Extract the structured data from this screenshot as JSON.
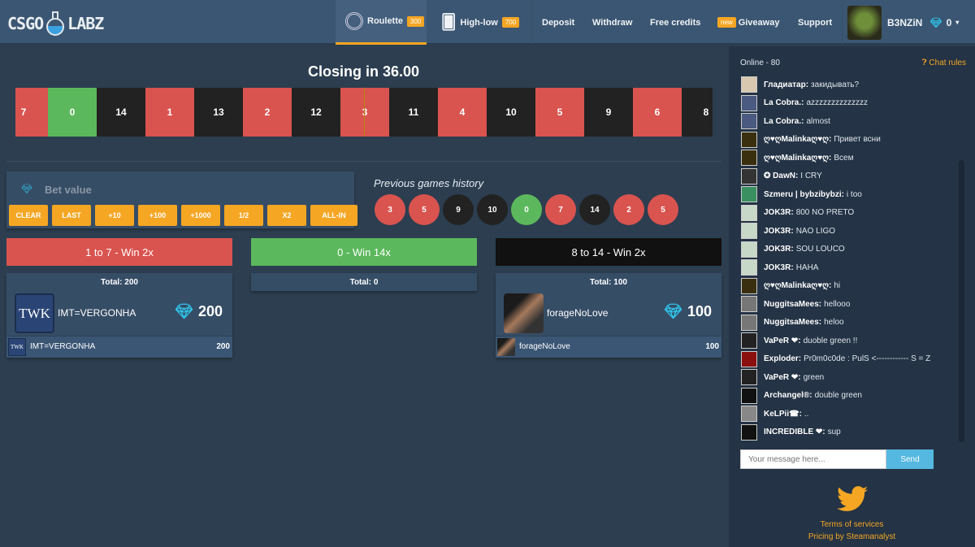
{
  "header": {
    "logo_left": "CSGO",
    "logo_right": "LABZ",
    "nav": [
      {
        "label": "Roulette",
        "badge": "300"
      },
      {
        "label": "High-low",
        "badge": "700"
      },
      {
        "label": "Deposit"
      },
      {
        "label": "Withdraw"
      },
      {
        "label": "Free credits"
      },
      {
        "label": "Giveaway",
        "badge": "new"
      },
      {
        "label": "Support"
      }
    ],
    "user": {
      "name": "B3NZiN",
      "balance": "0"
    }
  },
  "roulette": {
    "title": "Closing in 36.00",
    "tiles": [
      {
        "n": "7",
        "c": "red"
      },
      {
        "n": "0",
        "c": "green"
      },
      {
        "n": "14",
        "c": "black"
      },
      {
        "n": "1",
        "c": "red"
      },
      {
        "n": "13",
        "c": "black"
      },
      {
        "n": "2",
        "c": "red"
      },
      {
        "n": "12",
        "c": "black"
      },
      {
        "n": "3",
        "c": "red"
      },
      {
        "n": "11",
        "c": "black"
      },
      {
        "n": "4",
        "c": "red"
      },
      {
        "n": "10",
        "c": "black"
      },
      {
        "n": "5",
        "c": "red"
      },
      {
        "n": "9",
        "c": "black"
      },
      {
        "n": "6",
        "c": "red"
      },
      {
        "n": "8",
        "c": "black"
      }
    ]
  },
  "colors": {
    "red": "#d9534f",
    "green": "#5cb85c",
    "black": "#222222",
    "accent": "#f5a623",
    "gem": "#2fc4ea"
  },
  "bet": {
    "label": "Bet value",
    "buttons": [
      "CLEAR",
      "LAST",
      "+10",
      "+100",
      "+1000",
      "1/2",
      "X2",
      "ALL-IN"
    ]
  },
  "history": {
    "label": "Previous games history",
    "balls": [
      {
        "n": "3",
        "c": "red"
      },
      {
        "n": "5",
        "c": "red"
      },
      {
        "n": "9",
        "c": "black"
      },
      {
        "n": "10",
        "c": "black"
      },
      {
        "n": "0",
        "c": "green"
      },
      {
        "n": "7",
        "c": "red"
      },
      {
        "n": "14",
        "c": "black"
      },
      {
        "n": "2",
        "c": "red"
      },
      {
        "n": "5",
        "c": "red"
      }
    ]
  },
  "columns": [
    {
      "label": "1 to 7 - Win 2x",
      "color": "red",
      "total": "Total: 200",
      "top": {
        "name": "IMT=VERGONHA",
        "amount": "200",
        "avatar_text": "TWK"
      },
      "bets": [
        {
          "name": "IMT=VERGONHA",
          "amount": "200",
          "avatar_text": "TWK"
        }
      ]
    },
    {
      "label": "0 - Win 14x",
      "color": "green",
      "total": "Total: 0"
    },
    {
      "label": "8 to 14 - Win 2x",
      "color": "black",
      "total": "Total: 100",
      "top": {
        "name": "forageNoLove",
        "amount": "100"
      },
      "bets": [
        {
          "name": "forageNoLove",
          "amount": "100"
        }
      ]
    }
  ],
  "chat": {
    "online": "Online - 80",
    "rules": "Chat rules",
    "messages": [
      {
        "user": "Гладиатар:",
        "text": "закидывать?",
        "av": "#d8c8b0"
      },
      {
        "user": "La Cobra.:",
        "text": "azzzzzzzzzzzzzz",
        "av": "#4a5a80"
      },
      {
        "user": "La Cobra.:",
        "text": "almost",
        "av": "#4a5a80"
      },
      {
        "user": "ღ♥ღMalinkaღ♥ღ:",
        "text": "Привет всни",
        "av": "#3a3010"
      },
      {
        "user": "ღ♥ღMalinkaღ♥ღ:",
        "text": "Всем",
        "av": "#3a3010"
      },
      {
        "user": "✪ DawN:",
        "text": "I CRY",
        "av": "#333"
      },
      {
        "user": "Szmeru | bybzibybzi:",
        "text": "i too",
        "av": "#3a9060"
      },
      {
        "user": "JOK3R:",
        "text": "800 NO PRETO",
        "av": "#c8d8c8"
      },
      {
        "user": "JOK3R:",
        "text": "NAO LIGO",
        "av": "#c8d8c8"
      },
      {
        "user": "JOK3R:",
        "text": "SOU LOUCO",
        "av": "#c8d8c8"
      },
      {
        "user": "JOK3R:",
        "text": "HAHA",
        "av": "#c8d8c8"
      },
      {
        "user": "ღ♥ღMalinkaღ♥ღ:",
        "text": "hi",
        "av": "#3a3010"
      },
      {
        "user": "NuggitsaMees:",
        "text": "hellooo",
        "av": "#777"
      },
      {
        "user": "NuggitsaMees:",
        "text": "heloo",
        "av": "#777"
      },
      {
        "user": "VaPeR ❤:",
        "text": "duoble green !!",
        "av": "#222"
      },
      {
        "user": "Exploder:",
        "text": "Pr0m0c0de : PulS <------------ S = Z",
        "av": "#8a1010"
      },
      {
        "user": "VaPeR ❤:",
        "text": "green",
        "av": "#222"
      },
      {
        "user": "Archangel®:",
        "text": "double green",
        "av": "#111"
      },
      {
        "user": "KeLPii☎:",
        "text": "..",
        "av": "#888"
      },
      {
        "user": "INCREDIBLE ❤:",
        "text": "sup",
        "av": "#111"
      }
    ],
    "placeholder": "Your message here...",
    "send": "Send",
    "footer": [
      "Terms of services",
      "Pricing by Steamanalyst"
    ]
  }
}
